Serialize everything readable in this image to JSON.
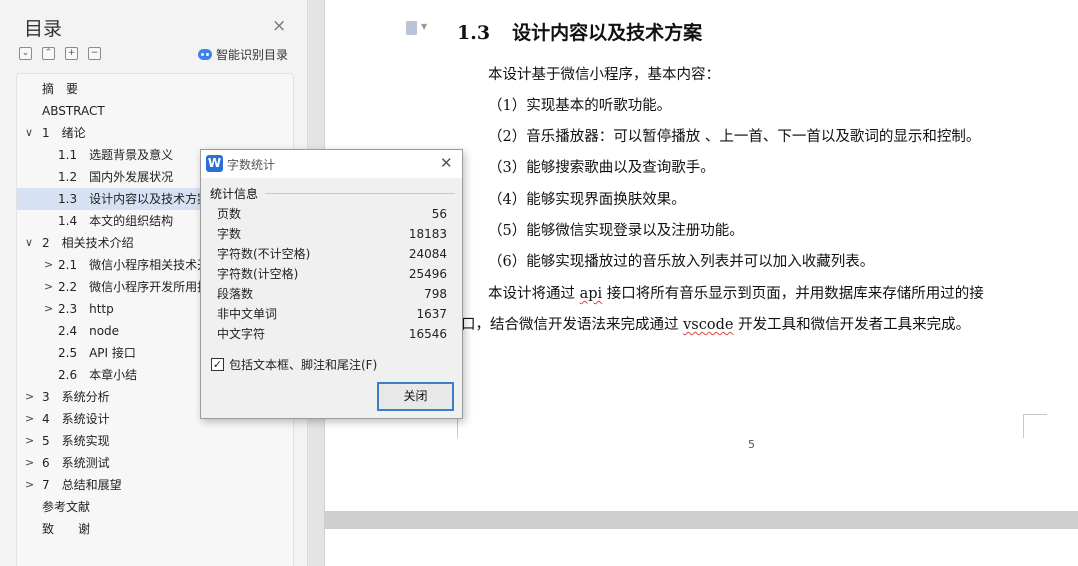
{
  "toc": {
    "title": "目录",
    "close_glyph": "×",
    "tools": [
      "⌄",
      "⌃",
      "+",
      "−"
    ],
    "smart_label": "智能识别目录",
    "items": [
      {
        "label": "摘　要",
        "chev": ""
      },
      {
        "label": "ABSTRACT",
        "chev": ""
      },
      {
        "label": "1　绪论",
        "chev": "∨"
      },
      {
        "label": "1.1　选题背景及意义",
        "chev": ""
      },
      {
        "label": "1.2　国内外发展状况",
        "chev": ""
      },
      {
        "label": "1.3　设计内容以及技术方案",
        "chev": "",
        "selected": true
      },
      {
        "label": "1.4　本文的组织结构",
        "chev": ""
      },
      {
        "label": "2　相关技术介绍",
        "chev": "∨"
      },
      {
        "label": "2.1　微信小程序相关技术开发",
        "chev": ">"
      },
      {
        "label": "2.2　微信小程序开发所用技术",
        "chev": ">"
      },
      {
        "label": "2.3　http",
        "chev": ">"
      },
      {
        "label": "2.4　node",
        "chev": ""
      },
      {
        "label": "2.5　API 接口",
        "chev": ""
      },
      {
        "label": "2.6　本章小结",
        "chev": ""
      },
      {
        "label": "3　系统分析",
        "chev": ">"
      },
      {
        "label": "4　系统设计",
        "chev": ">"
      },
      {
        "label": "5　系统实现",
        "chev": ">"
      },
      {
        "label": "6　系统测试",
        "chev": ">"
      },
      {
        "label": "7　总结和展望",
        "chev": ">"
      },
      {
        "label": "参考文献",
        "chev": ""
      },
      {
        "label": "致　　谢",
        "chev": ""
      }
    ]
  },
  "doc": {
    "heading_num": "1.3",
    "heading_text": "设计内容以及技术方案",
    "intro": "本设计基于微信小程序，基本内容：",
    "list": [
      "（1）实现基本的听歌功能。",
      "（2）音乐播放器：可以暂停播放 、上一首、下一首以及歌词的显示和控制。",
      "（3）能够搜索歌曲以及查询歌手。",
      "（4）能够实现界面换肤效果。",
      "（5）能够微信实现登录以及注册功能。",
      "（6）能够实现播放过的音乐放入列表并可以加入收藏列表。"
    ],
    "para2_a": "本设计将通过 ",
    "para2_api": "api",
    "para2_b": " 接口将所有音乐显示到页面，并用数据库来存储所用过的接",
    "para3_a": "口，结合微信开发语法来完成通过 ",
    "para3_vscode": "vscode",
    "para3_b": " 开发工具和微信开发者工具来完成。",
    "page_number": "5"
  },
  "dialog": {
    "logo": "W",
    "title": "字数统计",
    "close_glyph": "✕",
    "group_label": "统计信息",
    "stats": [
      {
        "label": "页数",
        "value": "56"
      },
      {
        "label": "字数",
        "value": "18183"
      },
      {
        "label": "字符数(不计空格)",
        "value": "24084"
      },
      {
        "label": "字符数(计空格)",
        "value": "25496"
      },
      {
        "label": "段落数",
        "value": "798"
      },
      {
        "label": "非中文单词",
        "value": "1637"
      },
      {
        "label": "中文字符",
        "value": "16546"
      }
    ],
    "checkbox_label": "包括文本框、脚注和尾注(F)",
    "checkbox_mark": "✓",
    "close_button": "关闭"
  },
  "colors": {
    "accent": "#3c7fc6",
    "selected_row": "#d6e2f3",
    "logo": "#2d6fd8"
  }
}
